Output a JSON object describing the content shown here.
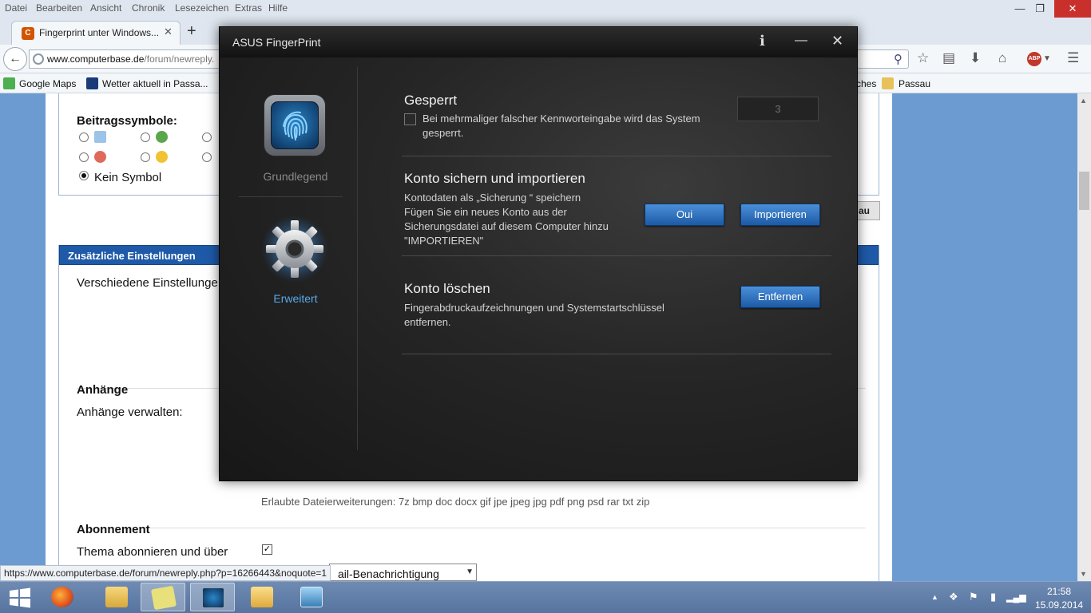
{
  "browser": {
    "menu": [
      "Datei",
      "Bearbeiten",
      "Ansicht",
      "Chronik",
      "Lesezeichen",
      "Extras",
      "Hilfe"
    ],
    "tab_title": "Fingerprint unter Windows...",
    "url_domain": "www.computerbase.de",
    "url_path": "/forum/newreply.",
    "bookmarks": [
      "Google Maps",
      "Wetter aktuell in Passa...",
      "ches",
      "Passau"
    ],
    "status_url": "https://www.computerbase.de/forum/newreply.php?p=16266443&noquote=1"
  },
  "page": {
    "symbols_label": "Beitragssymbole:",
    "no_symbol": "Kein Symbol",
    "extra_settings_header": "Zusätzliche Einstellungen",
    "misc_settings": "Verschiedene Einstellunge",
    "partial_button": "au",
    "attachments_title": "Anhänge",
    "attachments_manage": "Anhänge verwalten:",
    "allowed_ext": "Erlaubte Dateierweiterungen: 7z bmp doc docx gif jpe jpeg jpg pdf png psd rar txt zip",
    "subscription_title": "Abonnement",
    "subscribe_label": "Thema abonnieren und über",
    "notify_select": "ail-Benachrichtigung"
  },
  "dialog": {
    "title": "ASUS FingerPrint",
    "info": "i",
    "nav_basic": "Grundlegend",
    "nav_advanced": "Erweitert",
    "lock": {
      "title": "Gesperrt",
      "desc_line1": "Bei mehrmaliger falscher Kennworteingabe wird das System",
      "desc_line2": "gesperrt.",
      "count": "3"
    },
    "backup": {
      "title": "Konto sichern und importieren",
      "line1": "Kontodaten als „Sicherung  “ speichern",
      "line2": "Fügen Sie ein neues Konto aus der",
      "line3": "Sicherungsdatei auf diesem Computer hinzu",
      "line4": "\"IMPORTIEREN\"",
      "ok_button": "Oui",
      "import_button": "Importieren"
    },
    "delete": {
      "title": "Konto löschen",
      "line1": "Fingerabdruckaufzeichnungen und Systemstartschlüssel",
      "line2": "entfernen.",
      "remove_button": "Entfernen"
    }
  },
  "taskbar": {
    "time": "21:58",
    "date": "15.09.2014"
  },
  "colors": {
    "accent_blue": "#2b6cc0",
    "link_blue": "#59a8e8",
    "page_background": "#6b9bd1"
  }
}
